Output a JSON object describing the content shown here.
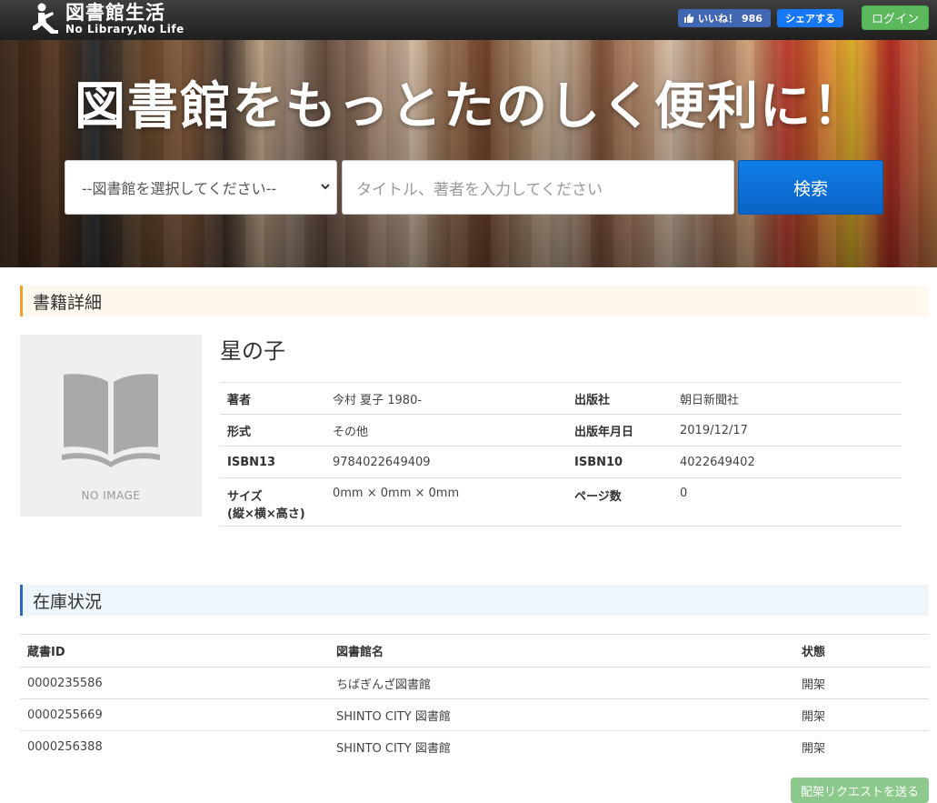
{
  "header": {
    "site_title": "図書館生活",
    "site_subtitle": "No Library,No Life",
    "like_label": "いいね！",
    "like_count": "986",
    "share_label": "シェアする",
    "login_label": "ログイン"
  },
  "hero": {
    "headline": "図書館をもっとたのしく便利に！",
    "library_select_value": "--図書館を選択してください--",
    "search_placeholder": "タイトル、著者を入力してください",
    "search_button": "検索"
  },
  "detail": {
    "section_title": "書籍詳細",
    "no_image_label": "NO IMAGE",
    "book_title": "星の子",
    "rows": [
      {
        "k1": "著者",
        "v1": "今村 夏子 1980-",
        "k2": "出版社",
        "v2": "朝日新聞社"
      },
      {
        "k1": "形式",
        "v1": "その他",
        "k2": "出版年月日",
        "v2": "2019/12/17"
      },
      {
        "k1": "ISBN13",
        "v1": "9784022649409",
        "k2": "ISBN10",
        "v2": "4022649402"
      },
      {
        "k1": "サイズ",
        "k1b": "(縦×横×高さ)",
        "v1": "0mm × 0mm × 0mm",
        "k2": "ページ数",
        "v2": "0"
      }
    ]
  },
  "stock": {
    "section_title": "在庫状況",
    "columns": [
      "蔵書ID",
      "図書館名",
      "状態"
    ],
    "rows": [
      {
        "id": "0000235586",
        "library": "ちばぎんざ図書館",
        "status": "開架"
      },
      {
        "id": "0000255669",
        "library": "SHINTO CITY 図書館",
        "status": "開架"
      },
      {
        "id": "0000256388",
        "library": "SHINTO CITY 図書館",
        "status": "開架"
      }
    ],
    "request_button": "配架リクエストを送る"
  },
  "colors": {
    "header_bg": "#2b2b2b",
    "login_green": "#5cb85c",
    "search_blue": "#0a6fd6",
    "facebook_blue": "#4267b2",
    "detail_accent": "#f0a030",
    "stock_accent": "#2a6ab8"
  }
}
